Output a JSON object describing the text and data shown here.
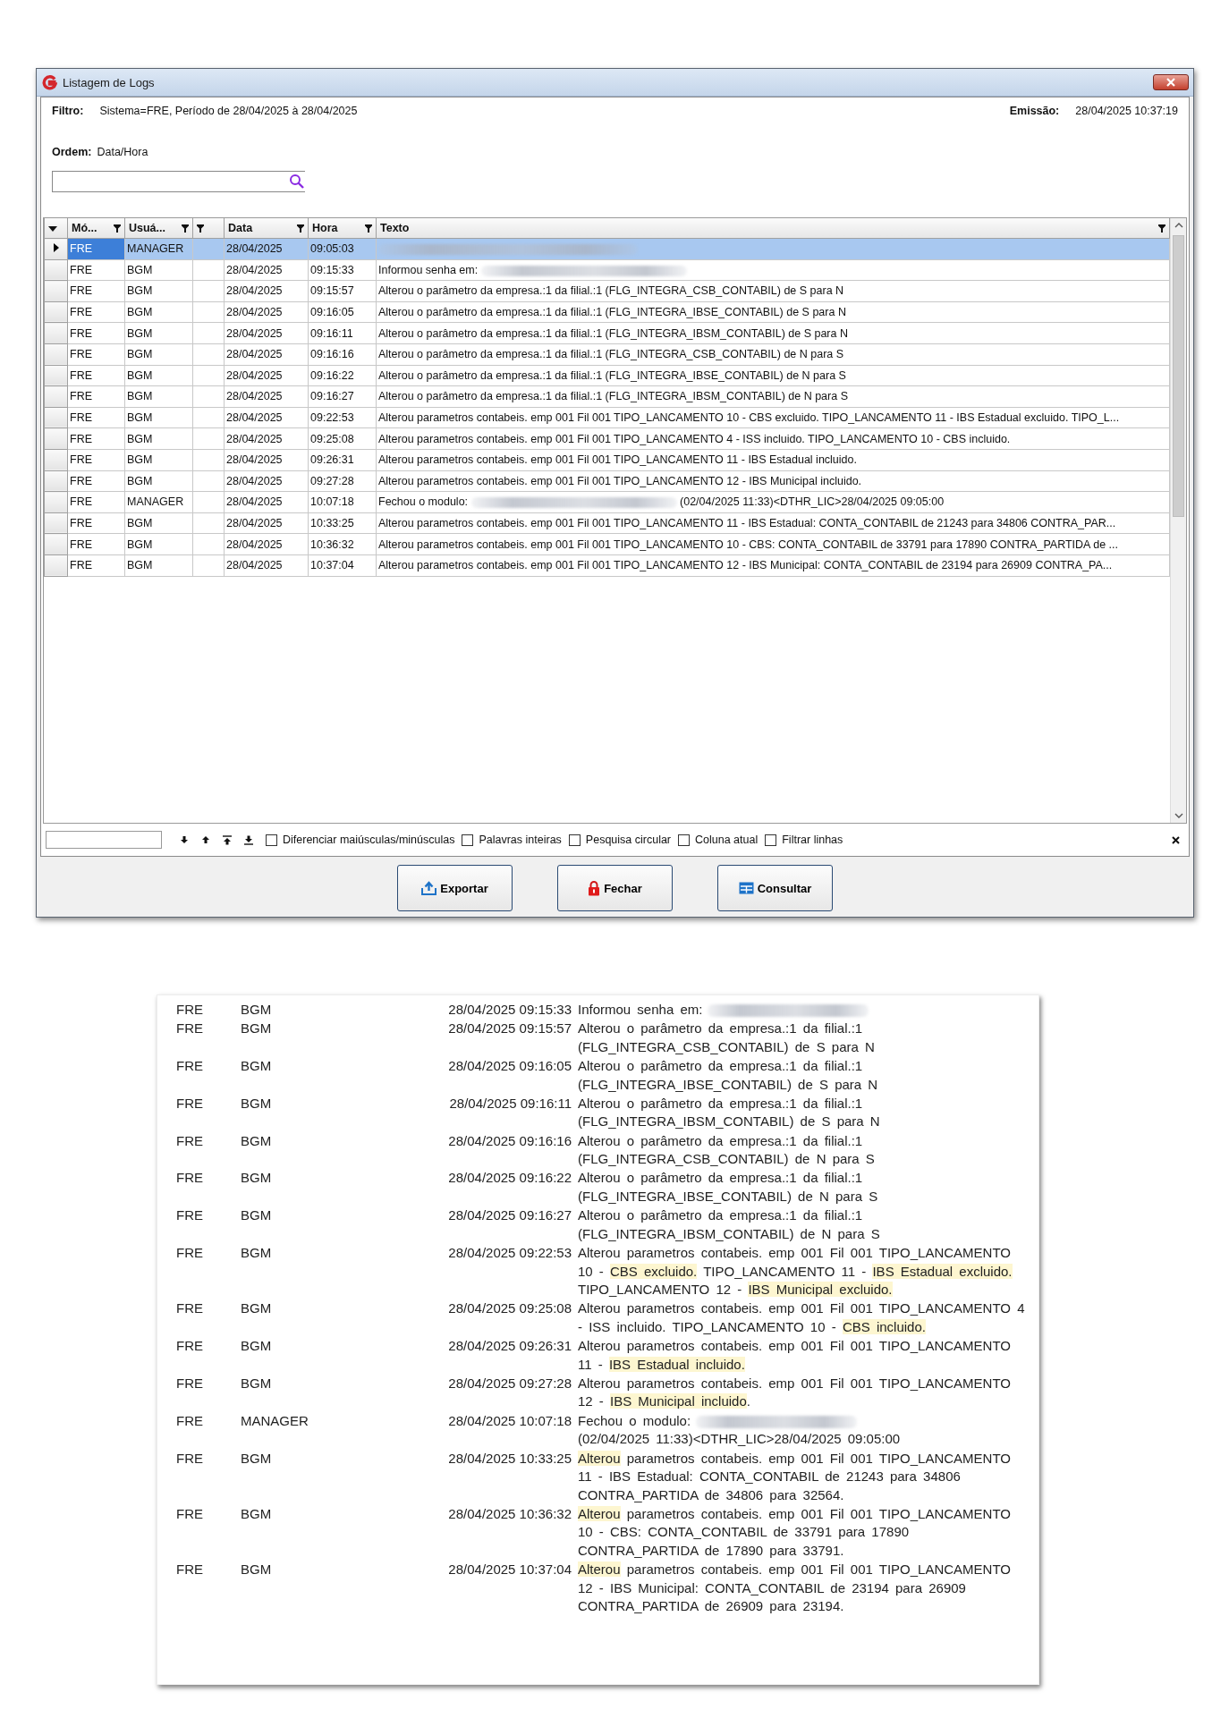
{
  "window": {
    "title": "Listagem de Logs"
  },
  "filter": {
    "label": "Filtro:",
    "value": "Sistema=FRE, Período de 28/04/2025 à 28/04/2025"
  },
  "issued": {
    "label": "Emissão:",
    "value": "28/04/2025 10:37:19"
  },
  "order": {
    "label": "Ordem:",
    "value": "Data/Hora"
  },
  "table": {
    "columns": [
      {
        "label": "Mó..."
      },
      {
        "label": "Usuá..."
      },
      {},
      {
        "label": "Data"
      },
      {
        "label": "Hora"
      },
      {
        "label": "Texto"
      }
    ],
    "rows": [
      {
        "selected": true,
        "module": "FRE",
        "user": "MANAGER",
        "date": "28/04/2025",
        "time": "09:05:03",
        "text": [
          {
            "kind": "redacted"
          }
        ]
      },
      {
        "selected": false,
        "module": "FRE",
        "user": "BGM",
        "date": "28/04/2025",
        "time": "09:15:33",
        "text": [
          {
            "kind": "text",
            "text": "Informou senha em: "
          },
          {
            "kind": "redacted"
          }
        ]
      },
      {
        "selected": false,
        "module": "FRE",
        "user": "BGM",
        "date": "28/04/2025",
        "time": "09:15:57",
        "text": [
          {
            "kind": "text",
            "text": "Alterou o parâmetro da empresa.:1 da filial.:1 (FLG_INTEGRA_CSB_CONTABIL) de S para N"
          }
        ]
      },
      {
        "selected": false,
        "module": "FRE",
        "user": "BGM",
        "date": "28/04/2025",
        "time": "09:16:05",
        "text": [
          {
            "kind": "text",
            "text": "Alterou o parâmetro da empresa.:1 da filial.:1 (FLG_INTEGRA_IBSE_CONTABIL) de S para N"
          }
        ]
      },
      {
        "selected": false,
        "module": "FRE",
        "user": "BGM",
        "date": "28/04/2025",
        "time": "09:16:11",
        "text": [
          {
            "kind": "text",
            "text": "Alterou o parâmetro da empresa.:1 da filial.:1 (FLG_INTEGRA_IBSM_CONTABIL) de S para N"
          }
        ]
      },
      {
        "selected": false,
        "module": "FRE",
        "user": "BGM",
        "date": "28/04/2025",
        "time": "09:16:16",
        "text": [
          {
            "kind": "text",
            "text": "Alterou o parâmetro da empresa.:1 da filial.:1 (FLG_INTEGRA_CSB_CONTABIL) de N para S"
          }
        ]
      },
      {
        "selected": false,
        "module": "FRE",
        "user": "BGM",
        "date": "28/04/2025",
        "time": "09:16:22",
        "text": [
          {
            "kind": "text",
            "text": "Alterou o parâmetro da empresa.:1 da filial.:1 (FLG_INTEGRA_IBSE_CONTABIL) de N para S"
          }
        ]
      },
      {
        "selected": false,
        "module": "FRE",
        "user": "BGM",
        "date": "28/04/2025",
        "time": "09:16:27",
        "text": [
          {
            "kind": "text",
            "text": "Alterou o parâmetro da empresa.:1 da filial.:1 (FLG_INTEGRA_IBSM_CONTABIL) de N para S"
          }
        ]
      },
      {
        "selected": false,
        "module": "FRE",
        "user": "BGM",
        "date": "28/04/2025",
        "time": "09:22:53",
        "text": [
          {
            "kind": "text",
            "text": "Alterou parametros contabeis. emp 001 Fil 001 TIPO_LANCAMENTO 10 - CBS excluido. TIPO_LANCAMENTO 11 - IBS Estadual excluido. TIPO_L..."
          }
        ]
      },
      {
        "selected": false,
        "module": "FRE",
        "user": "BGM",
        "date": "28/04/2025",
        "time": "09:25:08",
        "text": [
          {
            "kind": "text",
            "text": "Alterou parametros contabeis. emp 001 Fil 001 TIPO_LANCAMENTO 4 - ISS incluido. TIPO_LANCAMENTO 10 - CBS incluido."
          }
        ]
      },
      {
        "selected": false,
        "module": "FRE",
        "user": "BGM",
        "date": "28/04/2025",
        "time": "09:26:31",
        "text": [
          {
            "kind": "text",
            "text": "Alterou parametros contabeis. emp 001 Fil 001 TIPO_LANCAMENTO 11 - IBS Estadual incluido."
          }
        ]
      },
      {
        "selected": false,
        "module": "FRE",
        "user": "BGM",
        "date": "28/04/2025",
        "time": "09:27:28",
        "text": [
          {
            "kind": "text",
            "text": "Alterou parametros contabeis. emp 001 Fil 001 TIPO_LANCAMENTO 12 - IBS Municipal incluido."
          }
        ]
      },
      {
        "selected": false,
        "module": "FRE",
        "user": "MANAGER",
        "date": "28/04/2025",
        "time": "10:07:18",
        "text": [
          {
            "kind": "text",
            "text": "Fechou o modulo: "
          },
          {
            "kind": "redacted"
          },
          {
            "kind": "text",
            "text": " (02/04/2025 11:33)<DTHR_LIC>28/04/2025 09:05:00"
          }
        ]
      },
      {
        "selected": false,
        "module": "FRE",
        "user": "BGM",
        "date": "28/04/2025",
        "time": "10:33:25",
        "text": [
          {
            "kind": "text",
            "text": "Alterou parametros contabeis. emp 001 Fil 001 TIPO_LANCAMENTO 11 - IBS Estadual: CONTA_CONTABIL de 21243 para 34806 CONTRA_PAR..."
          }
        ]
      },
      {
        "selected": false,
        "module": "FRE",
        "user": "BGM",
        "date": "28/04/2025",
        "time": "10:36:32",
        "text": [
          {
            "kind": "text",
            "text": "Alterou parametros contabeis. emp 001 Fil 001 TIPO_LANCAMENTO 10 - CBS: CONTA_CONTABIL de 33791 para 17890 CONTRA_PARTIDA de ..."
          }
        ]
      },
      {
        "selected": false,
        "module": "FRE",
        "user": "BGM",
        "date": "28/04/2025",
        "time": "10:37:04",
        "text": [
          {
            "kind": "text",
            "text": "Alterou parametros contabeis. emp 001 Fil 001 TIPO_LANCAMENTO 12 - IBS Municipal: CONTA_CONTABIL de 23194 para 26909 CONTRA_PA..."
          }
        ]
      }
    ]
  },
  "find_bar": {
    "options": [
      {
        "label": "Diferenciar maiúsculas/minúsculas",
        "checked": false
      },
      {
        "label": "Palavras inteiras",
        "checked": false
      },
      {
        "label": "Pesquisa circular",
        "checked": false
      },
      {
        "label": "Coluna atual",
        "checked": false
      },
      {
        "label": "Filtrar linhas",
        "checked": false
      }
    ]
  },
  "buttons": [
    {
      "label": "Exportar",
      "kind": "export"
    },
    {
      "label": "Fechar",
      "kind": "close"
    },
    {
      "label": "Consultar",
      "kind": "query"
    }
  ],
  "report": {
    "rows": [
      {
        "module": "FRE",
        "user": "BGM",
        "datetime": "28/04/2025 09:15:33",
        "text": [
          {
            "kind": "text",
            "text": "Informou senha em: "
          },
          {
            "kind": "redacted"
          }
        ]
      },
      {
        "module": "FRE",
        "user": "BGM",
        "datetime": "28/04/2025 09:15:57",
        "text": [
          {
            "kind": "text",
            "text": "Alterou o parâmetro da empresa.:1 da filial.:1 (FLG_INTEGRA_CSB_CONTABIL) de S para N"
          }
        ]
      },
      {
        "module": "FRE",
        "user": "BGM",
        "datetime": "28/04/2025 09:16:05",
        "text": [
          {
            "kind": "text",
            "text": "Alterou o parâmetro da empresa.:1 da filial.:1 (FLG_INTEGRA_IBSE_CONTABIL) de S para N"
          }
        ]
      },
      {
        "module": "FRE",
        "user": "BGM",
        "datetime": "28/04/2025 09:16:11",
        "text": [
          {
            "kind": "text",
            "text": "Alterou o parâmetro da empresa.:1 da filial.:1 (FLG_INTEGRA_IBSM_CONTABIL) de S para N"
          }
        ]
      },
      {
        "module": "FRE",
        "user": "BGM",
        "datetime": "28/04/2025 09:16:16",
        "text": [
          {
            "kind": "text",
            "text": "Alterou o parâmetro da empresa.:1 da filial.:1 (FLG_INTEGRA_CSB_CONTABIL) de N para S"
          }
        ]
      },
      {
        "module": "FRE",
        "user": "BGM",
        "datetime": "28/04/2025 09:16:22",
        "text": [
          {
            "kind": "text",
            "text": "Alterou o parâmetro da empresa.:1 da filial.:1 (FLG_INTEGRA_IBSE_CONTABIL) de N para S"
          }
        ]
      },
      {
        "module": "FRE",
        "user": "BGM",
        "datetime": "28/04/2025 09:16:27",
        "text": [
          {
            "kind": "text",
            "text": "Alterou o parâmetro da empresa.:1 da filial.:1 (FLG_INTEGRA_IBSM_CONTABIL) de N para S"
          }
        ]
      },
      {
        "module": "FRE",
        "user": "BGM",
        "datetime": "28/04/2025 09:22:53",
        "text": [
          {
            "kind": "text",
            "text": "Alterou parametros contabeis. emp 001 Fil 001 TIPO_LANCAMENTO 10 - "
          },
          {
            "kind": "mark",
            "text": "CBS excluido."
          },
          {
            "kind": "text",
            "text": " TIPO_LANCAMENTO 11 - "
          },
          {
            "kind": "mark",
            "text": "IBS Estadual excluido."
          },
          {
            "kind": "text",
            "text": " TIPO_LANCAMENTO 12 - "
          },
          {
            "kind": "mark",
            "text": "IBS Municipal excluido."
          }
        ]
      },
      {
        "module": "FRE",
        "user": "BGM",
        "datetime": "28/04/2025 09:25:08",
        "text": [
          {
            "kind": "text",
            "text": "Alterou parametros contabeis. emp 001 Fil 001 TIPO_LANCAMENTO 4 - ISS incluido. TIPO_LANCAMENTO 10 - "
          },
          {
            "kind": "mark",
            "text": "CBS incluido."
          }
        ]
      },
      {
        "module": "FRE",
        "user": "BGM",
        "datetime": "28/04/2025 09:26:31",
        "text": [
          {
            "kind": "text",
            "text": "Alterou parametros contabeis. emp 001 Fil 001 TIPO_LANCAMENTO 11 - "
          },
          {
            "kind": "mark",
            "text": "IBS Estadual incluido."
          }
        ]
      },
      {
        "module": "FRE",
        "user": "BGM",
        "datetime": "28/04/2025 09:27:28",
        "text": [
          {
            "kind": "text",
            "text": "Alterou parametros contabeis. emp 001 Fil 001 TIPO_LANCAMENTO 12 - "
          },
          {
            "kind": "mark",
            "text": "IBS Municipal incluido"
          },
          {
            "kind": "text",
            "text": "."
          }
        ]
      },
      {
        "module": "FRE",
        "user": "MANAGER",
        "datetime": "28/04/2025 10:07:18",
        "text": [
          {
            "kind": "text",
            "text": "Fechou o modulo: "
          },
          {
            "kind": "redacted"
          },
          {
            "kind": "text",
            "text": " (02/04/2025 11:33)<DTHR_LIC>28/04/2025 09:05:00"
          }
        ]
      },
      {
        "module": "FRE",
        "user": "BGM",
        "datetime": "28/04/2025 10:33:25",
        "text": [
          {
            "kind": "mark",
            "text": "Alterou"
          },
          {
            "kind": "text",
            "text": " parametros contabeis. emp 001 Fil 001 TIPO_LANCAMENTO 11 - IBS Estadual: CONTA_CONTABIL de 21243 para 34806 CONTRA_PARTIDA de 34806 para 32564."
          }
        ]
      },
      {
        "module": "FRE",
        "user": "BGM",
        "datetime": "28/04/2025 10:36:32",
        "text": [
          {
            "kind": "mark",
            "text": "Alterou"
          },
          {
            "kind": "text",
            "text": " parametros contabeis. emp 001 Fil 001 TIPO_LANCAMENTO 10 - CBS: CONTA_CONTABIL de 33791 para 17890 CONTRA_PARTIDA de 17890 para 33791."
          }
        ]
      },
      {
        "module": "FRE",
        "user": "BGM",
        "datetime": "28/04/2025 10:37:04",
        "text": [
          {
            "kind": "mark",
            "text": "Alterou"
          },
          {
            "kind": "text",
            "text": " parametros contabeis. emp 001 Fil 001 TIPO_LANCAMENTO 12 - IBS Municipal: CONTA_CONTABIL de 23194 para 26909 CONTRA_PARTIDA de 26909 para 23194."
          }
        ]
      }
    ]
  }
}
